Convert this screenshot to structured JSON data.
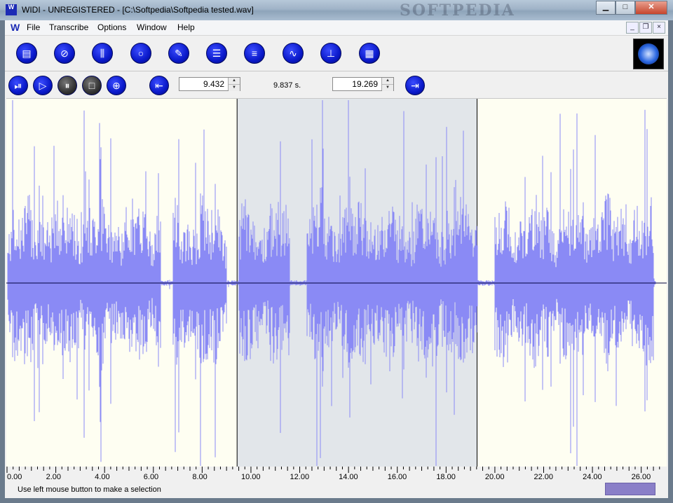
{
  "window": {
    "title": "WIDI - UNREGISTERED - [C:\\Softpedia\\Softpedia tested.wav]",
    "watermark": "SOFTPEDIA",
    "app_icon": "W"
  },
  "menu": {
    "items": [
      "File",
      "Transcribe",
      "Options",
      "Window",
      "Help"
    ]
  },
  "toolbar_main": {
    "icons": [
      "new-document-icon",
      "no-document-icon",
      "spectrum-icon",
      "circle-icon",
      "microphone-icon",
      "list-icon",
      "bars-icon",
      "waveform-icon",
      "pitch-icon",
      "stack-icon"
    ]
  },
  "toolbar_transport": {
    "icons": [
      "play-selection-icon",
      "play-icon",
      "pause-icon",
      "stop-icon",
      "loop-icon"
    ],
    "selection_start": "9.432",
    "selection_length": "9.837 s.",
    "selection_end": "19.269"
  },
  "waveform": {
    "duration": 26.9,
    "selection_start": 9.432,
    "selection_end": 19.269,
    "wave_color": "#8a8af5",
    "background_color": "#fefef2",
    "selection_color": "#e2e6ea"
  },
  "ruler": {
    "labels": [
      "0.00",
      "2.00",
      "4.00",
      "6.00",
      "8.00",
      "10.00",
      "12.00",
      "14.00",
      "16.00",
      "18.00",
      "20.00",
      "22.00",
      "24.00",
      "26.00"
    ],
    "values": [
      0,
      2,
      4,
      6,
      8,
      10,
      12,
      14,
      16,
      18,
      20,
      22,
      24,
      26
    ]
  },
  "status": {
    "text": "Use left mouse button to make a selection"
  }
}
